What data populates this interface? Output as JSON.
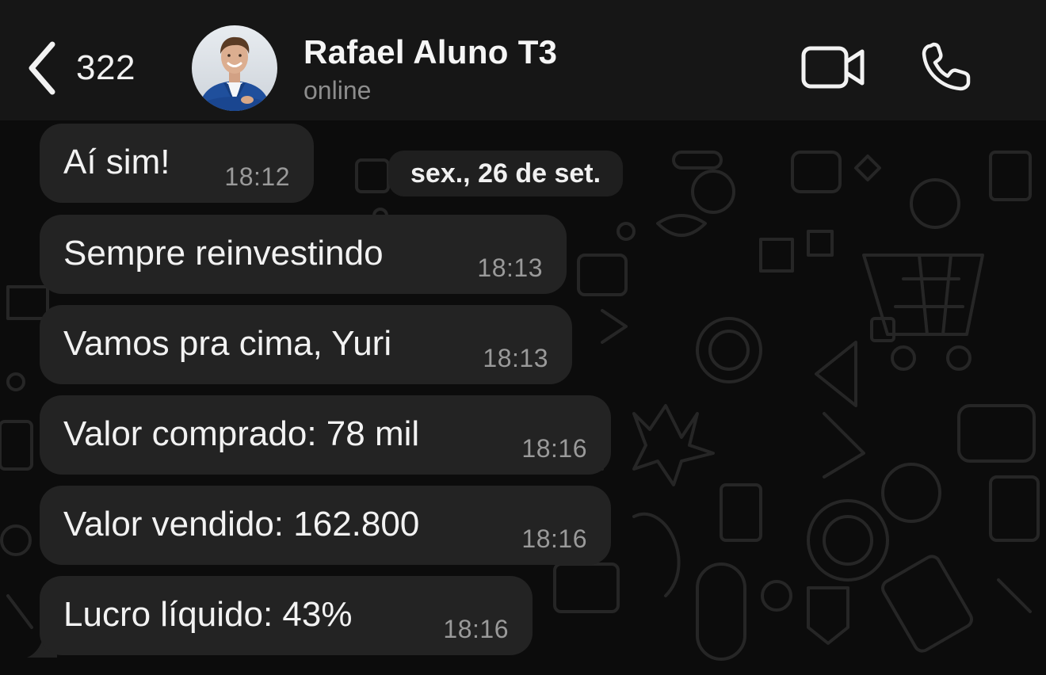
{
  "header": {
    "back_count": "322",
    "contact_name": "Rafael Aluno T3",
    "contact_status": "online"
  },
  "chat": {
    "date_separator": "sex., 26 de set.",
    "messages": [
      {
        "text": "Aí sim!",
        "time": "18:12"
      },
      {
        "text": "Sempre reinvestindo",
        "time": "18:13"
      },
      {
        "text": "Vamos pra cima, Yuri",
        "time": "18:13"
      },
      {
        "text": "Valor comprado: 78 mil",
        "time": "18:16"
      },
      {
        "text": "Valor vendido: 162.800",
        "time": "18:16"
      },
      {
        "text": "Lucro líquido: 43%",
        "time": "18:16"
      }
    ]
  },
  "colors": {
    "header_bg": "#161616",
    "chat_bg": "#0c0c0c",
    "bubble_bg": "#232323",
    "text_primary": "#f2f2f2",
    "text_secondary": "#8d8d8d"
  },
  "icons": {
    "back": "chevron-left-icon",
    "video": "video-camera-icon",
    "call": "phone-icon"
  }
}
